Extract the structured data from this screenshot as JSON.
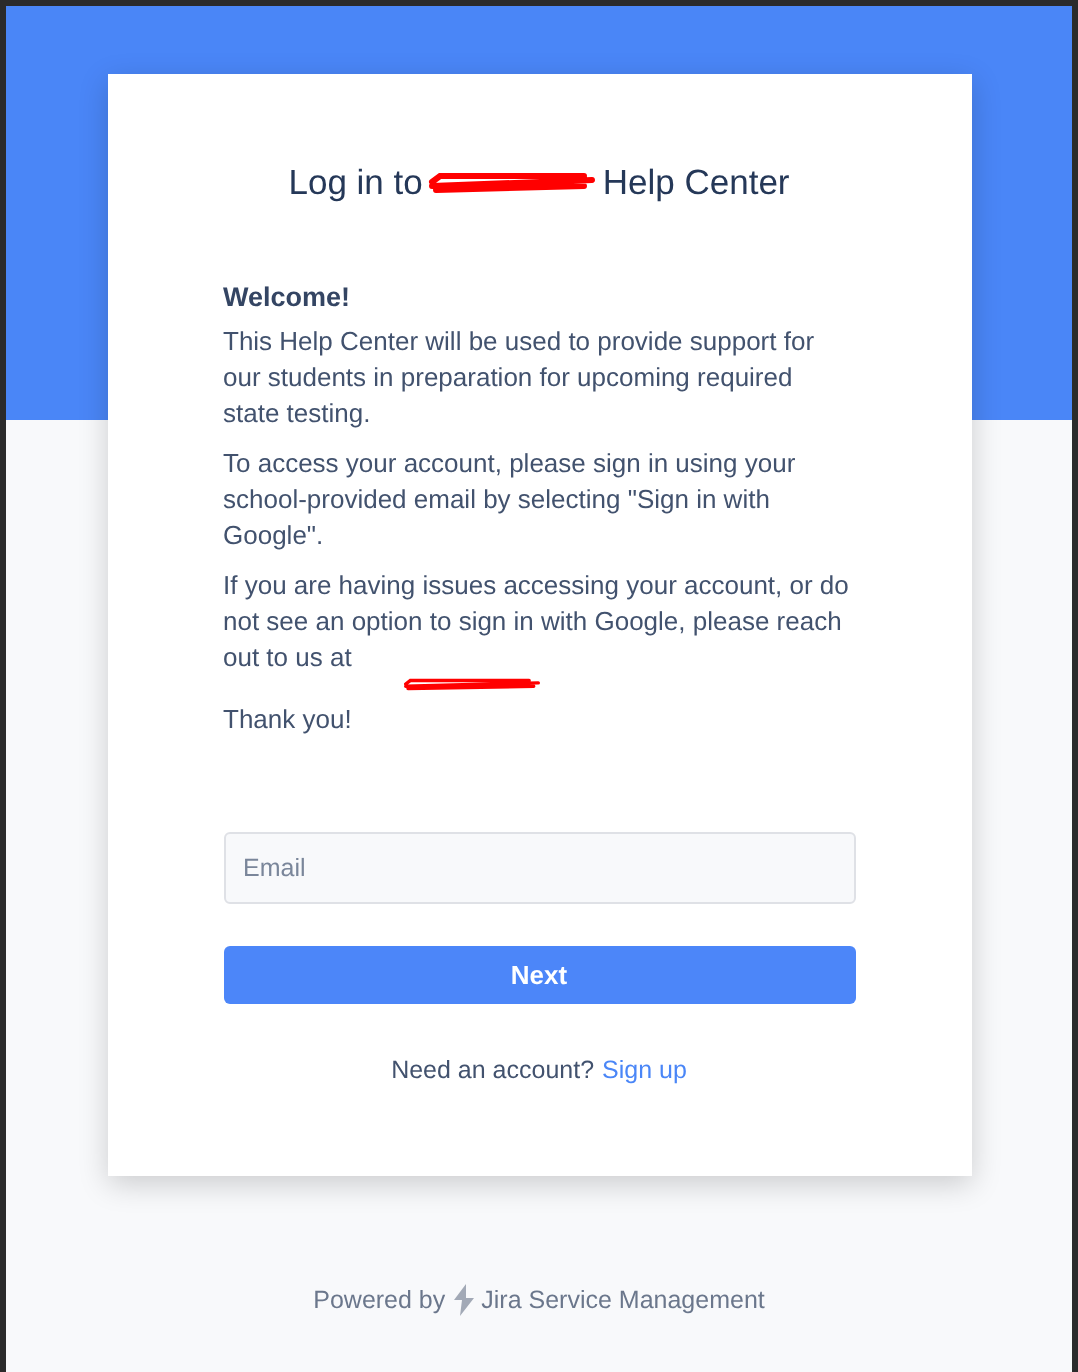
{
  "title": {
    "before": "Log in to",
    "after": "Help Center",
    "redacted": true
  },
  "message": {
    "heading": "Welcome!",
    "paragraphs": [
      {
        "text": "This Help Center will be used to provide support for our students in preparation for upcoming required state testing."
      },
      {
        "text": "To access your account, please sign in using your school-provided email by selecting \"Sign in with Google\"."
      },
      {
        "text": "If you are having issues accessing your account, or do not see an option to sign in with Google, please reach out to us at",
        "redacted": true
      },
      {
        "text": "Thank you!"
      }
    ]
  },
  "email_field": {
    "placeholder": "Email"
  },
  "next_button": "Next",
  "signup": {
    "prompt": "Need an account?",
    "link": "Sign up"
  },
  "footer": {
    "prefix": "Powered by",
    "product": "Jira Service Management"
  }
}
